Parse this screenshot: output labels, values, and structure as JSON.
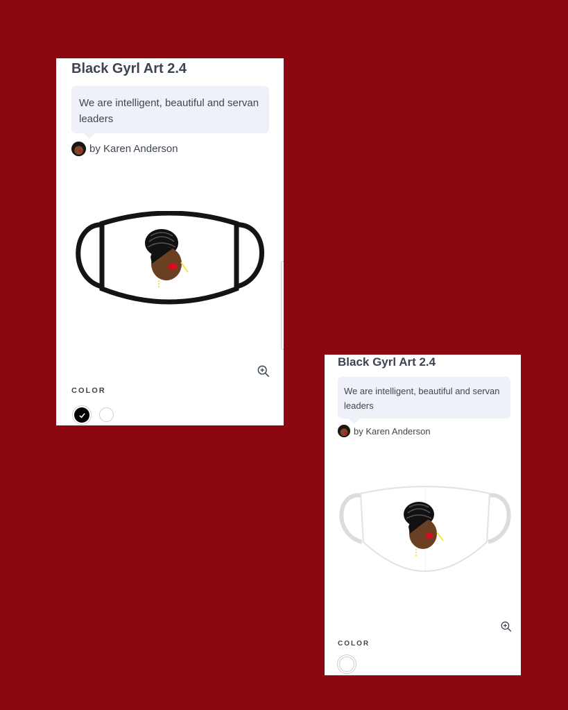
{
  "cards": [
    {
      "title": "Black Gyrl Art 2.4",
      "description": "We are intelligent, beautiful and servan leaders",
      "byline": "by Karen Anderson",
      "product": "black-trim-face-mask",
      "color_label": "COLOR",
      "colors": [
        {
          "name": "black",
          "hex": "#000000",
          "selected": true
        },
        {
          "name": "white",
          "hex": "#ffffff",
          "selected": false
        }
      ]
    },
    {
      "title": "Black Gyrl Art 2.4",
      "description": "We are intelligent, beautiful and servan leaders",
      "byline": "by Karen Anderson",
      "product": "white-cloth-face-mask",
      "color_label": "COLOR",
      "colors": [
        {
          "name": "white",
          "hex": "#ffffff",
          "selected": true
        }
      ]
    }
  ],
  "theme": {
    "background": "#8c0710",
    "card": "#ffffff",
    "bubble": "#eef1f7",
    "text": "#3c4350"
  },
  "icons": [
    "zoom-in-icon",
    "checkmark-icon",
    "artist-avatar"
  ]
}
